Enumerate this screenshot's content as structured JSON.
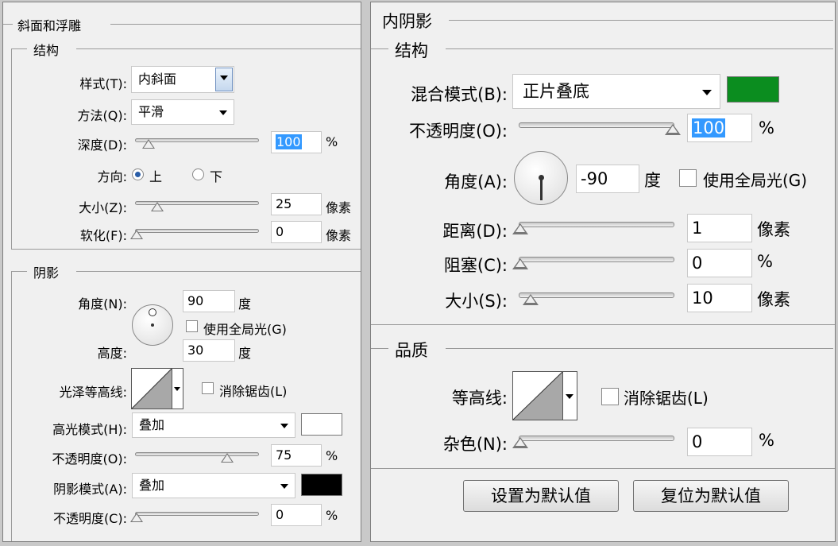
{
  "left": {
    "title": "斜面和浮雕",
    "structure": {
      "heading": "结构",
      "style_label": "样式(T):",
      "style_value": "内斜面",
      "method_label": "方法(Q):",
      "method_value": "平滑",
      "depth_label": "深度(D):",
      "depth_value": "100",
      "depth_slider": 10,
      "depth_unit": "%",
      "direction_label": "方向:",
      "direction_up": "上",
      "direction_down": "下",
      "size_label": "大小(Z):",
      "size_value": "25",
      "size_slider": 17,
      "size_unit": "像素",
      "soften_label": "软化(F):",
      "soften_value": "0",
      "soften_slider": 0,
      "soften_unit": "像素"
    },
    "shading": {
      "heading": "阴影",
      "angle_label": "角度(N):",
      "angle_value": "90",
      "angle_unit": "度",
      "global_light_label": "使用全局光(G)",
      "altitude_label": "高度:",
      "altitude_value": "30",
      "altitude_unit": "度",
      "gloss_contour_label": "光泽等高线:",
      "anti_alias_label": "消除锯齿(L)",
      "highlight_mode_label": "高光模式(H):",
      "highlight_mode_value": "叠加",
      "highlight_color": "#ffffff",
      "highlight_opacity_label": "不透明度(O):",
      "highlight_opacity_value": "75",
      "highlight_opacity_slider": 75,
      "highlight_opacity_unit": "%",
      "shadow_mode_label": "阴影模式(A):",
      "shadow_mode_value": "叠加",
      "shadow_color": "#000000",
      "shadow_opacity_label": "不透明度(C):",
      "shadow_opacity_value": "0",
      "shadow_opacity_slider": 0,
      "shadow_opacity_unit": "%"
    }
  },
  "right": {
    "title": "内阴影",
    "structure": {
      "heading": "结构",
      "blend_mode_label": "混合模式(B):",
      "blend_mode_value": "正片叠底",
      "blend_color": "#0b8d1f",
      "opacity_label": "不透明度(O):",
      "opacity_value": "100",
      "opacity_slider": 100,
      "opacity_unit": "%",
      "angle_label": "角度(A):",
      "angle_value": "-90",
      "angle_unit": "度",
      "global_light_label": "使用全局光(G)",
      "distance_label": "距离(D):",
      "distance_value": "1",
      "distance_slider": 0,
      "distance_unit": "像素",
      "choke_label": "阻塞(C):",
      "choke_value": "0",
      "choke_slider": 0,
      "choke_unit": "%",
      "size_label": "大小(S):",
      "size_value": "10",
      "size_slider": 7,
      "size_unit": "像素"
    },
    "quality": {
      "heading": "品质",
      "contour_label": "等高线:",
      "anti_alias_label": "消除锯齿(L)",
      "noise_label": "杂色(N):",
      "noise_value": "0",
      "noise_slider": 0,
      "noise_unit": "%"
    },
    "buttons": {
      "set_default": "设置为默认值",
      "reset_default": "复位为默认值"
    }
  }
}
